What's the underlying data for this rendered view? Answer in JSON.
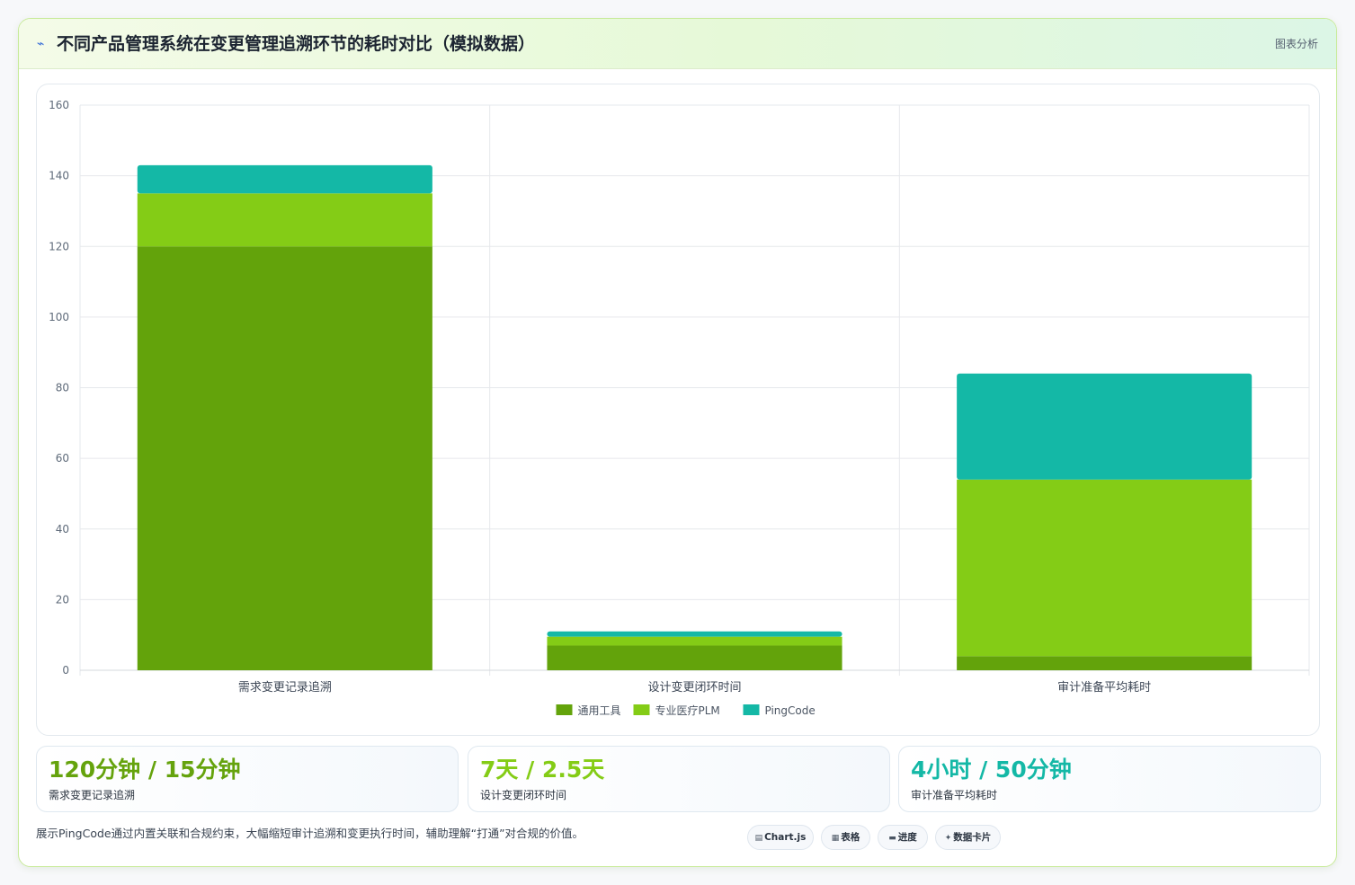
{
  "header": {
    "icon": "chart-line-icon",
    "title": "不同产品管理系统在变更管理追溯环节的耗时对比（模拟数据）",
    "tag": "图表分析"
  },
  "chart_data": {
    "type": "bar",
    "stacked": true,
    "categories": [
      "需求变更记录追溯",
      "设计变更闭环时间",
      "审计准备平均耗时"
    ],
    "series": [
      {
        "name": "通用工具",
        "values": [
          120,
          7,
          4
        ],
        "color": "#63a30b"
      },
      {
        "name": "专业医疗PLM",
        "values": [
          15,
          2.5,
          50
        ],
        "color": "#84cc16"
      },
      {
        "name": "PingCode",
        "values": [
          8,
          1.5,
          30
        ],
        "color": "#14b8a6"
      }
    ],
    "ylim": [
      0,
      160
    ],
    "yticks": [
      0,
      20,
      40,
      60,
      80,
      100,
      120,
      140,
      160
    ],
    "grid": true,
    "legend_position": "bottom"
  },
  "kpis": [
    {
      "value": "120分钟 / 15分钟",
      "label": "需求变更记录追溯",
      "color": "#65a30d"
    },
    {
      "value": "7天 / 2.5天",
      "label": "设计变更闭环时间",
      "color": "#84cc16"
    },
    {
      "value": "4小时 / 50分钟",
      "label": "审计准备平均耗时",
      "color": "#14b8a6"
    }
  ],
  "footnote": "展示PingCode通过内置关联和合规约束，大幅缩短审计追溯和变更执行时间，辅助理解“打通”对合规的价值。",
  "pills": [
    {
      "icon": "▤",
      "icon_name": "chart-icon",
      "label": "Chart.js"
    },
    {
      "icon": "▦",
      "icon_name": "table-icon",
      "label": "表格"
    },
    {
      "icon": "▬",
      "icon_name": "progress-icon",
      "label": "进度"
    },
    {
      "icon": "✦",
      "icon_name": "sparkle-icon",
      "label": "数据卡片"
    }
  ]
}
